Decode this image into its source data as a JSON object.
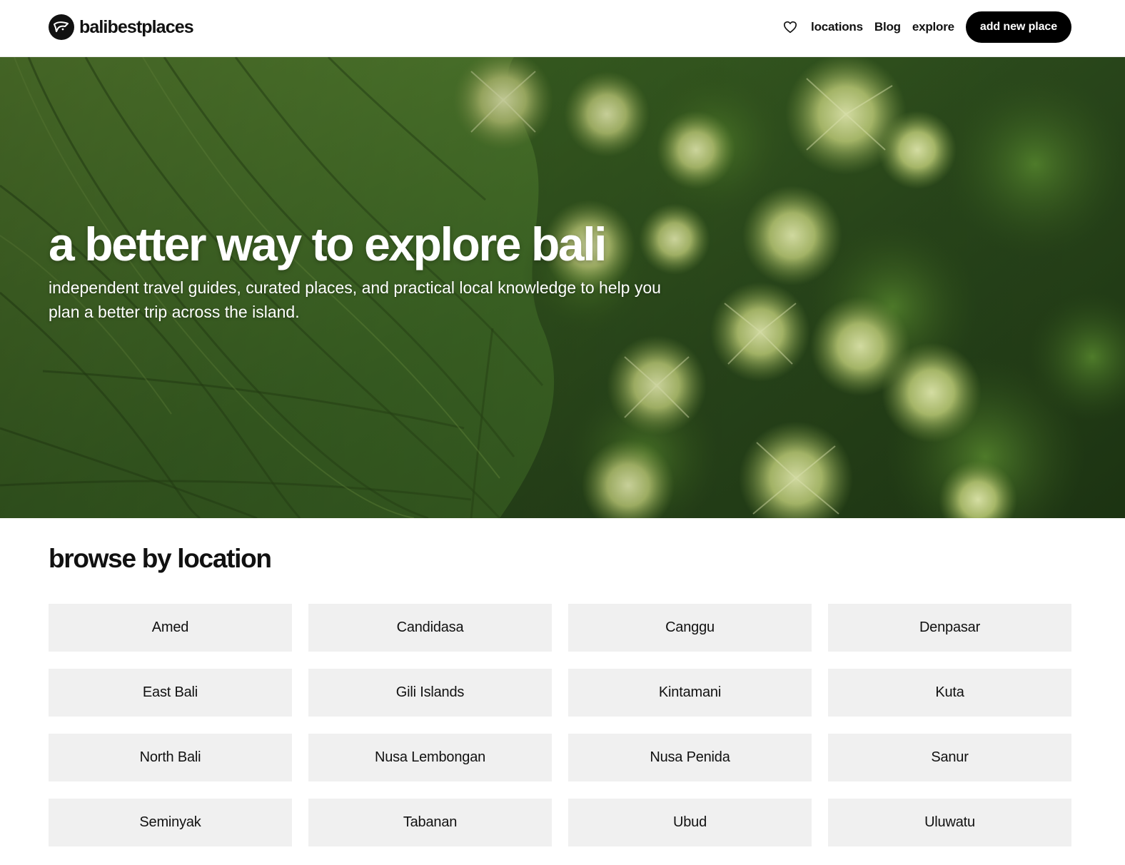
{
  "header": {
    "logo_text": "balibestplaces",
    "nav": {
      "favorites_icon": "heart-icon",
      "locations": "locations",
      "blog": "Blog",
      "explore": "explore",
      "cta": "add new place"
    }
  },
  "hero": {
    "title": "a better way to explore bali",
    "subtitle": "independent travel guides, curated places, and practical local knowledge to help you plan a better trip across the island."
  },
  "browse": {
    "title": "browse by location",
    "locations": [
      "Amed",
      "Candidasa",
      "Canggu",
      "Denpasar",
      "East Bali",
      "Gili Islands",
      "Kintamani",
      "Kuta",
      "North Bali",
      "Nusa Lembongan",
      "Nusa Penida",
      "Sanur",
      "Seminyak",
      "Tabanan",
      "Ubud",
      "Uluwatu"
    ]
  },
  "colors": {
    "cta_bg": "#000000",
    "tile_bg": "#f0f0f0",
    "text": "#111111"
  }
}
